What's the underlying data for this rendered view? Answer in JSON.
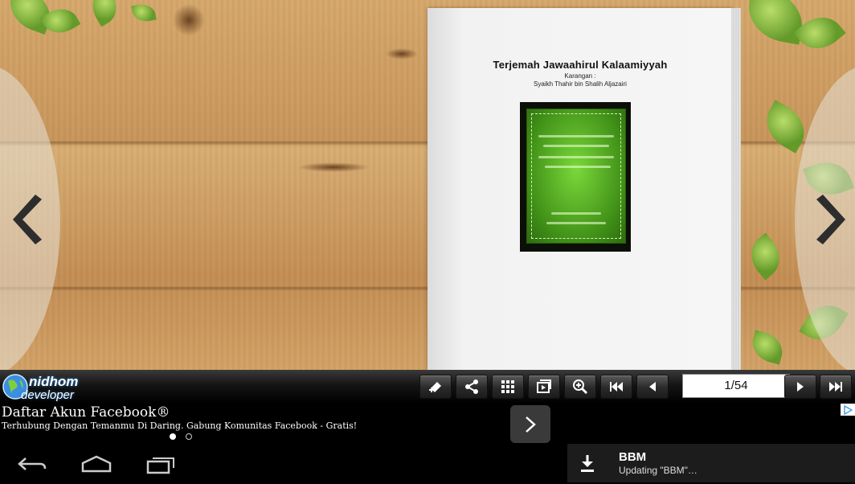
{
  "book": {
    "title": "Terjemah Jawaahirul Kalaamiyyah",
    "by_label": "Karangan :",
    "author": "Syaikh Thahir bin Shalih Aljazairi"
  },
  "toolbar": {
    "page_indicator": "1/54",
    "buttons": [
      "bookmark-add-icon",
      "share-icon",
      "grid-icon",
      "slideshow-icon",
      "zoom-in-icon",
      "first-page-icon",
      "previous-page-icon",
      "next-page-icon",
      "last-page-icon"
    ]
  },
  "logo": {
    "name": "nidhom",
    "sub": "developer"
  },
  "ad": {
    "title": "Daftar Akun Facebook®",
    "text": "Terhubung Dengan Temanmu Di Daring. Gabung Komunitas Facebook - Gratis!"
  },
  "notification": {
    "title": "BBM",
    "subtitle": "Updating \"BBM\"…"
  },
  "colors": {
    "wood": "#c8955a",
    "cover_green": "#4fa321",
    "toolbar": "#1b1b1b"
  }
}
